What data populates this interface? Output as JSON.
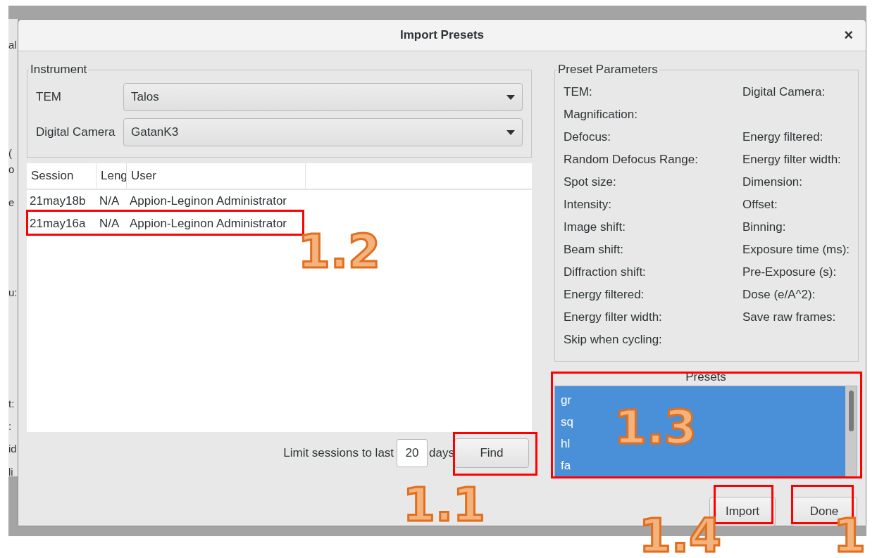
{
  "background_window": {
    "fragments": [
      "al",
      "(",
      "o",
      "e",
      "u:",
      "t:",
      ":",
      "id",
      "li"
    ]
  },
  "dialog": {
    "title": "Import Presets",
    "close": "×",
    "instrument": {
      "legend": "Instrument",
      "fields": [
        {
          "label": "TEM",
          "value": "Talos"
        },
        {
          "label": "Digital Camera",
          "value": "GatanK3"
        }
      ]
    },
    "table": {
      "columns": [
        "Session",
        "Leng",
        "User"
      ],
      "rows": [
        {
          "cells": [
            "21may18b",
            "N/A",
            "Appion-Leginon Administrator"
          ],
          "selected": false
        },
        {
          "cells": [
            "21may16a",
            "N/A",
            "Appion-Leginon Administrator"
          ],
          "selected": false
        }
      ]
    },
    "limit": {
      "label": "Limit sessions to last",
      "value": "20",
      "unit": "days",
      "button": "Find"
    },
    "preset_parameters": {
      "legend": "Preset Parameters",
      "rows": [
        [
          "TEM:",
          "Digital Camera:"
        ],
        [
          "Magnification:"
        ],
        [
          "Defocus:",
          "Energy filtered:"
        ],
        [
          "Random Defocus Range:",
          "Energy filter width:"
        ],
        [
          "Spot size:",
          "Dimension:"
        ],
        [
          "Intensity:",
          "Offset:"
        ],
        [
          "Image shift:",
          "Binning:"
        ],
        [
          "Beam shift:",
          "Exposure time (ms):"
        ],
        [
          "Diffraction shift:",
          "Pre-Exposure (s):"
        ],
        [
          "Energy filtered:",
          "Dose (e/A^2):"
        ],
        [
          "Energy filter width:",
          "Save raw frames:"
        ],
        [
          "Skip when cycling:"
        ]
      ]
    },
    "presets": {
      "label": "Presets",
      "items": [
        {
          "name": "gr",
          "selected": true
        },
        {
          "name": "sq",
          "selected": true
        },
        {
          "name": "hl",
          "selected": true
        },
        {
          "name": "fa",
          "selected": true
        }
      ]
    },
    "buttons": [
      "Import",
      "Done"
    ]
  },
  "annotations": [
    {
      "label": "1.1"
    },
    {
      "label": "1.2"
    },
    {
      "label": "1.3"
    },
    {
      "label": "1.4"
    },
    {
      "label": "1"
    }
  ]
}
